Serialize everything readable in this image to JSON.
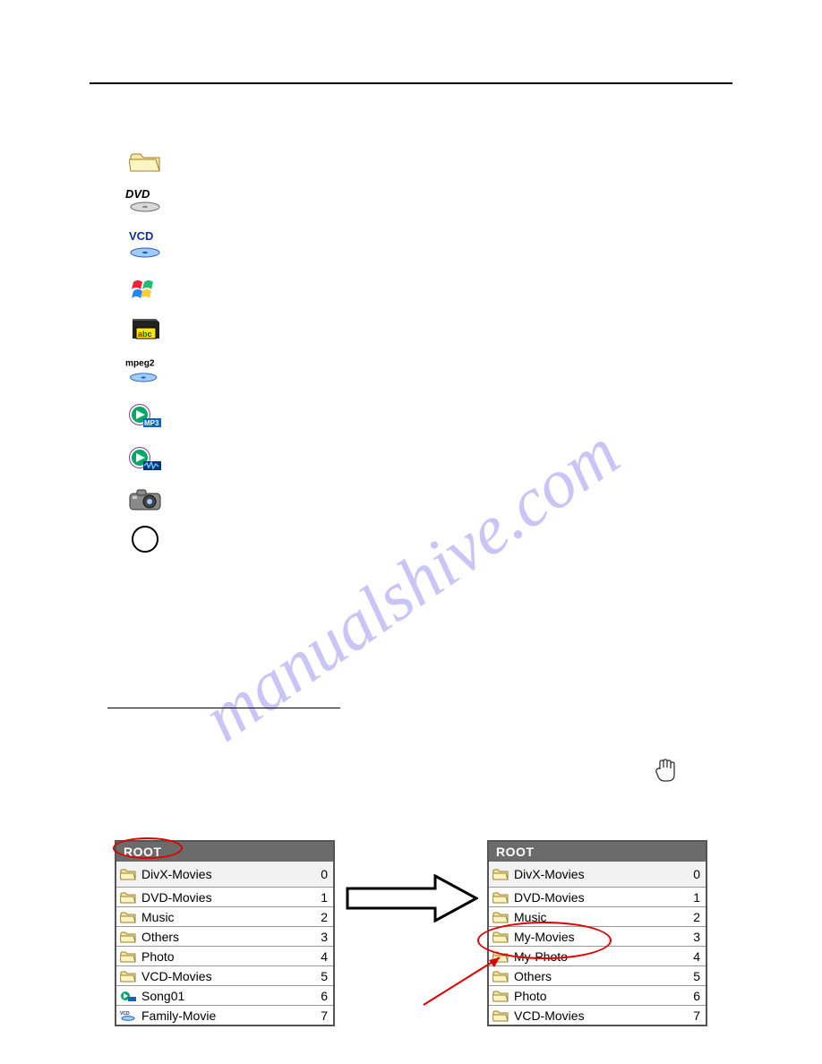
{
  "watermark": "manualshive.com",
  "icons": {
    "folder": "folder-icon",
    "dvd": "DVD",
    "vcd": "VCD",
    "windows": "windows-icon",
    "abc": "abc",
    "mpeg2": "mpeg2",
    "mp3": "MP3",
    "wma": "wma-icon",
    "camera": "camera-icon",
    "blank": "blank-circle"
  },
  "left_list": {
    "header": "ROOT",
    "rows": [
      {
        "icon": "folder",
        "name": "DivX-Movies",
        "idx": "0"
      },
      {
        "icon": "folder",
        "name": "DVD-Movies",
        "idx": "1"
      },
      {
        "icon": "folder",
        "name": "Music",
        "idx": "2"
      },
      {
        "icon": "folder",
        "name": "Others",
        "idx": "3"
      },
      {
        "icon": "folder",
        "name": "Photo",
        "idx": "4"
      },
      {
        "icon": "folder",
        "name": "VCD-Movies",
        "idx": "5"
      },
      {
        "icon": "mp3",
        "name": "Song01",
        "idx": "6"
      },
      {
        "icon": "vcd",
        "name": "Family-Movie",
        "idx": "7"
      }
    ]
  },
  "right_list": {
    "header": "ROOT",
    "rows": [
      {
        "icon": "folder",
        "name": "DivX-Movies",
        "idx": "0"
      },
      {
        "icon": "folder",
        "name": "DVD-Movies",
        "idx": "1"
      },
      {
        "icon": "folder",
        "name": "Music",
        "idx": "2"
      },
      {
        "icon": "folder",
        "name": "My-Movies",
        "idx": "3"
      },
      {
        "icon": "folder",
        "name": "My-Photo",
        "idx": "4"
      },
      {
        "icon": "folder",
        "name": "Others",
        "idx": "5"
      },
      {
        "icon": "folder",
        "name": "Photo",
        "idx": "6"
      },
      {
        "icon": "folder",
        "name": "VCD-Movies",
        "idx": "7"
      }
    ]
  }
}
